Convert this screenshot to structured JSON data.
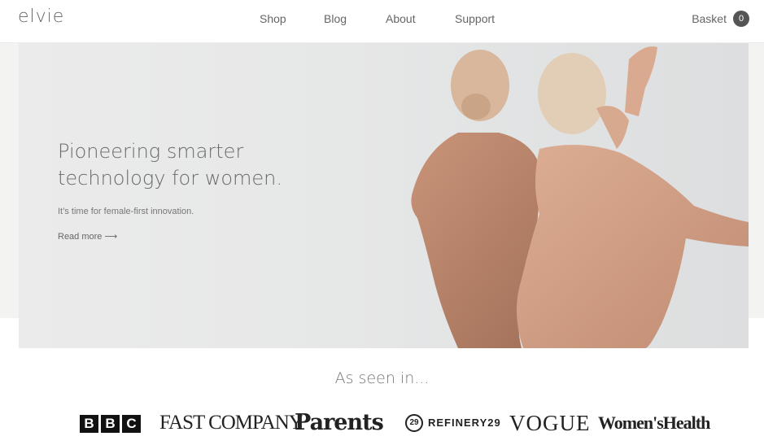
{
  "header": {
    "logo": "elvie",
    "nav": [
      {
        "label": "Shop"
      },
      {
        "label": "Blog"
      },
      {
        "label": "About"
      },
      {
        "label": "Support"
      }
    ],
    "basket_label": "Basket",
    "basket_count": "0"
  },
  "hero": {
    "title_line1": "Pioneering smarter",
    "title_line2": "technology for women.",
    "subtitle": "It’s time for female-first innovation.",
    "read_more": "Read more ⟶"
  },
  "press": {
    "heading": "As seen in...",
    "logos": [
      "BBC",
      "FASTCOMPANY",
      "Parents",
      "REFINERY29",
      "VOGUE",
      "WomensHealth"
    ],
    "bbc_letters": [
      "B",
      "B",
      "C"
    ],
    "fast_company": "FAST COMPANY",
    "parents": "Parents",
    "refinery_mark": "29",
    "refinery_text": "REFINERY29",
    "vogue": "VOGUE",
    "womens_health": "Women'sHealth"
  }
}
